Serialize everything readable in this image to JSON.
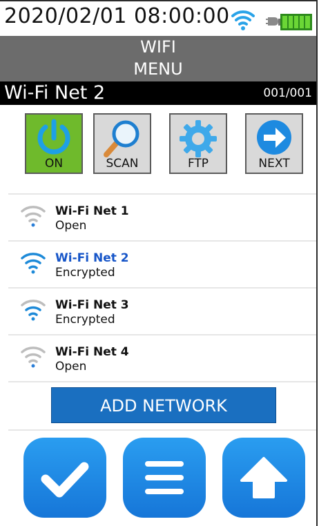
{
  "status_bar": {
    "datetime": "2020/02/01 08:00:00"
  },
  "title": {
    "line1": "WIFI",
    "line2": "MENU"
  },
  "current_network": {
    "name": "Wi-Fi Net 2",
    "counter": "001/001"
  },
  "tools": [
    {
      "label": "ON",
      "icon": "power-icon"
    },
    {
      "label": "SCAN",
      "icon": "magnifier-icon"
    },
    {
      "label": "FTP",
      "icon": "gear-icon"
    },
    {
      "label": "NEXT",
      "icon": "arrow-right-icon"
    }
  ],
  "networks": [
    {
      "name": "Wi-Fi Net 1",
      "security": "Open"
    },
    {
      "name": "Wi-Fi Net 2",
      "security": "Encrypted",
      "selected": true
    },
    {
      "name": "Wi-Fi Net 3",
      "security": "Encrypted"
    },
    {
      "name": "Wi-Fi Net 4",
      "security": "Open"
    }
  ],
  "add_network_label": "ADD NETWORK",
  "bottom_buttons": [
    {
      "icon": "checkmark-icon"
    },
    {
      "icon": "menu-icon"
    },
    {
      "icon": "arrow-up-icon"
    }
  ],
  "colors": {
    "accent_blue": "#1a6fc0",
    "on_green": "#6fba2c",
    "selected_text": "#1655c8"
  }
}
